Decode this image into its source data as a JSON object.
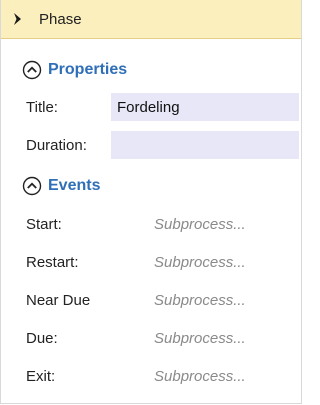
{
  "header": {
    "title": "Phase",
    "icon": "chevron-right-icon"
  },
  "properties": {
    "section_label": "Properties",
    "title_label": "Title:",
    "title_value": "Fordeling",
    "duration_label": "Duration:",
    "duration_value": ""
  },
  "events": {
    "section_label": "Events",
    "rows": [
      {
        "label": "Start:",
        "value": "Subprocess..."
      },
      {
        "label": "Restart:",
        "value": "Subprocess..."
      },
      {
        "label": "Near Due",
        "value": "Subprocess..."
      },
      {
        "label": "Due:",
        "value": "Subprocess..."
      },
      {
        "label": "Exit:",
        "value": "Subprocess..."
      }
    ]
  },
  "colors": {
    "header_bg": "#fbefbe",
    "section_accent": "#2f6fb7",
    "input_bg": "#e7e7f8"
  }
}
